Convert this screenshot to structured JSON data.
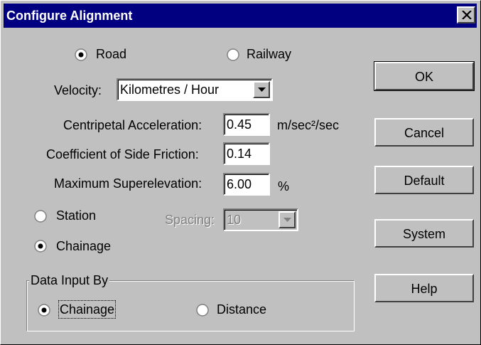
{
  "window": {
    "title": "Configure Alignment"
  },
  "mode": {
    "road_label": "Road",
    "railway_label": "Railway",
    "selected": "Road"
  },
  "velocity": {
    "label": "Velocity:",
    "value": "Kilometres / Hour"
  },
  "centripetal": {
    "label": "Centripetal Acceleration:",
    "value": "0.45",
    "unit": "m/sec²/sec"
  },
  "side_friction": {
    "label": "Coefficient of Side Friction:",
    "value": "0.14"
  },
  "superelevation": {
    "label": "Maximum Superelevation:",
    "value": "6.00",
    "unit": "%"
  },
  "referencing": {
    "station_label": "Station",
    "chainage_label": "Chainage",
    "selected": "Chainage"
  },
  "spacing": {
    "label": "Spacing:",
    "value": "10",
    "enabled": false
  },
  "data_input": {
    "group_label": "Data Input By",
    "chainage_label": "Chainage",
    "distance_label": "Distance",
    "selected": "Chainage"
  },
  "buttons": {
    "ok": "OK",
    "cancel": "Cancel",
    "default": "Default",
    "system": "System",
    "help": "Help"
  }
}
